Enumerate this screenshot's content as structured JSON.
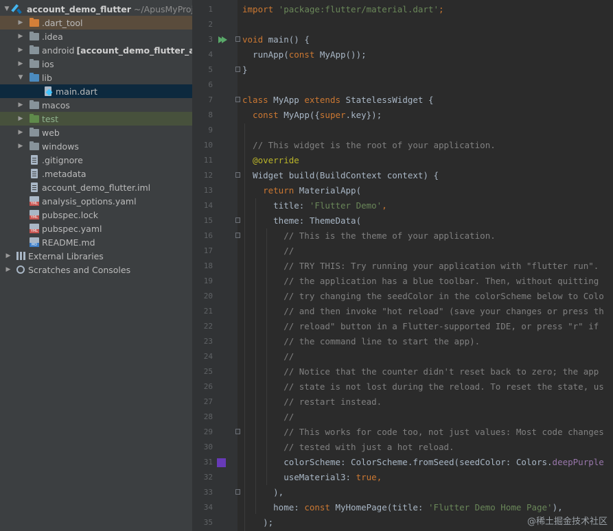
{
  "project_tree": {
    "root": {
      "name": "account_demo_flutter",
      "path": "~/ApusMyProje"
    },
    "items": [
      {
        "label": ".dart_tool",
        "icon": "orange-folder-icon"
      },
      {
        "label": ".idea",
        "icon": "grey-folder-icon"
      },
      {
        "label": "android",
        "suffix": "[account_demo_flutter_ar",
        "icon": "grey-folder-icon"
      },
      {
        "label": "ios",
        "icon": "grey-folder-icon"
      },
      {
        "label": "lib",
        "icon": "blue-folder-icon"
      },
      {
        "label": "main.dart",
        "icon": "dart-file-icon"
      },
      {
        "label": "macos",
        "icon": "grey-folder-icon"
      },
      {
        "label": "test",
        "icon": "green-folder-icon"
      },
      {
        "label": "web",
        "icon": "grey-folder-icon"
      },
      {
        "label": "windows",
        "icon": "grey-folder-icon"
      },
      {
        "label": ".gitignore",
        "icon": "file-icon"
      },
      {
        "label": ".metadata",
        "icon": "file-icon"
      },
      {
        "label": "account_demo_flutter.iml",
        "icon": "file-icon"
      },
      {
        "label": "analysis_options.yaml",
        "icon": "yaml-file-icon"
      },
      {
        "label": "pubspec.lock",
        "icon": "yaml-file-icon"
      },
      {
        "label": "pubspec.yaml",
        "icon": "yaml-file-icon"
      },
      {
        "label": "README.md",
        "icon": "markdown-file-icon"
      },
      {
        "label": "External Libraries",
        "icon": "libraries-icon"
      },
      {
        "label": "Scratches and Consoles",
        "icon": "scratches-icon"
      }
    ]
  },
  "editor": {
    "line_numbers": [
      "1",
      "2",
      "3",
      "4",
      "5",
      "6",
      "7",
      "8",
      "9",
      "10",
      "11",
      "12",
      "13",
      "14",
      "15",
      "16",
      "17",
      "18",
      "19",
      "20",
      "21",
      "22",
      "23",
      "24",
      "25",
      "26",
      "27",
      "28",
      "29",
      "30",
      "31",
      "32",
      "33",
      "34",
      "35"
    ],
    "swatch_color": "#673ab7",
    "tokens": {
      "l1_import": "import ",
      "l1_pkg": "'package:flutter/material.dart'",
      "l1_semi": ";",
      "l3_void": "void",
      "l3_rest": " main() {",
      "l4_a": "  runApp(",
      "l4_const": "const",
      "l4_b": " MyApp());",
      "l5": "}",
      "l7_class": "class",
      "l7_a": " MyApp ",
      "l7_extends": "extends",
      "l7_b": " StatelessWidget {",
      "l8_const": "  const",
      "l8_a": " MyApp({",
      "l8_super": "super",
      "l8_b": ".key});",
      "l10": "  // This widget is the root of your application.",
      "l11": "  @override",
      "l12": "  Widget build(BuildContext context) {",
      "l13_ret": "    return",
      "l13_a": " MaterialApp(",
      "l14_a": "      title: ",
      "l14_str": "'Flutter Demo'",
      "l14_b": ",",
      "l15": "      theme: ThemeData(",
      "l16": "        // This is the theme of your application.",
      "l17": "        //",
      "l18": "        // TRY THIS: Try running your application with \"flutter run\".",
      "l19": "        // the application has a blue toolbar. Then, without quitting",
      "l20": "        // try changing the seedColor in the colorScheme below to Colo",
      "l21": "        // and then invoke \"hot reload\" (save your changes or press th",
      "l22": "        // reload\" button in a Flutter-supported IDE, or press \"r\" if",
      "l23": "        // the command line to start the app).",
      "l24": "        //",
      "l25": "        // Notice that the counter didn't reset back to zero; the app",
      "l26": "        // state is not lost during the reload. To reset the state, us",
      "l27": "        // restart instead.",
      "l28": "        //",
      "l29": "        // This works for code too, not just values: Most code changes",
      "l30": "        // tested with just a hot reload.",
      "l31_a": "        colorScheme: ColorScheme.fromSeed(seedColor: Colors.",
      "l31_b": "deepPurple",
      "l32_a": "        useMaterial3: ",
      "l32_true": "true",
      "l32_b": ",",
      "l33": "      ),",
      "l34_a": "      home: ",
      "l34_const": "const",
      "l34_b": " MyHomePage(title: ",
      "l34_str": "'Flutter Demo Home Page'",
      "l34_c": "),",
      "l35": "    );"
    }
  },
  "watermark": "@稀土掘金技术社区"
}
